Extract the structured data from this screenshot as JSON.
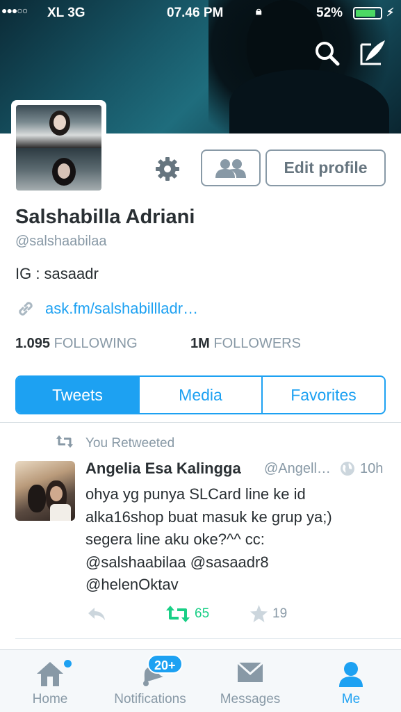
{
  "status_bar": {
    "signal": "●●●○○",
    "carrier": "XL  3G",
    "time": "07.46 PM",
    "battery_percent": "52%",
    "battery_level": 0.52
  },
  "header": {
    "search_icon": "search-icon",
    "compose_icon": "compose-icon"
  },
  "profile": {
    "name": "Salshabilla Adriani",
    "handle": "@salshaabilaa",
    "bio": "IG : sasaadr",
    "link": "ask.fm/salshabillladr…",
    "edit_profile_label": "Edit profile"
  },
  "stats": {
    "following_count": "1.095",
    "following_label": "FOLLOWING",
    "followers_count": "1M",
    "followers_label": "FOLLOWERS"
  },
  "tabs": [
    {
      "label": "Tweets",
      "active": true
    },
    {
      "label": "Media",
      "active": false
    },
    {
      "label": "Favorites",
      "active": false
    }
  ],
  "tweet": {
    "retweeted_label": "You Retweeted",
    "author_name": "Angelia Esa Kalingga",
    "author_handle": "@Angell…",
    "time": "10h",
    "text": "ohya yg punya SLCard line ke id\nalka16shop buat masuk ke grup ya;)\nsegera line aku oke?^^ cc:\n@salshaabilaa @sasaadr8\n@helenOktav",
    "retweet_count": "65",
    "favorite_count": "19"
  },
  "tab_bar": {
    "home": "Home",
    "notifications": "Notifications",
    "notifications_badge": "20+",
    "messages": "Messages",
    "me": "Me"
  },
  "colors": {
    "accent": "#1da1f2",
    "retweet_green": "#19cf86",
    "muted": "#8899a6",
    "text": "#292f33"
  }
}
